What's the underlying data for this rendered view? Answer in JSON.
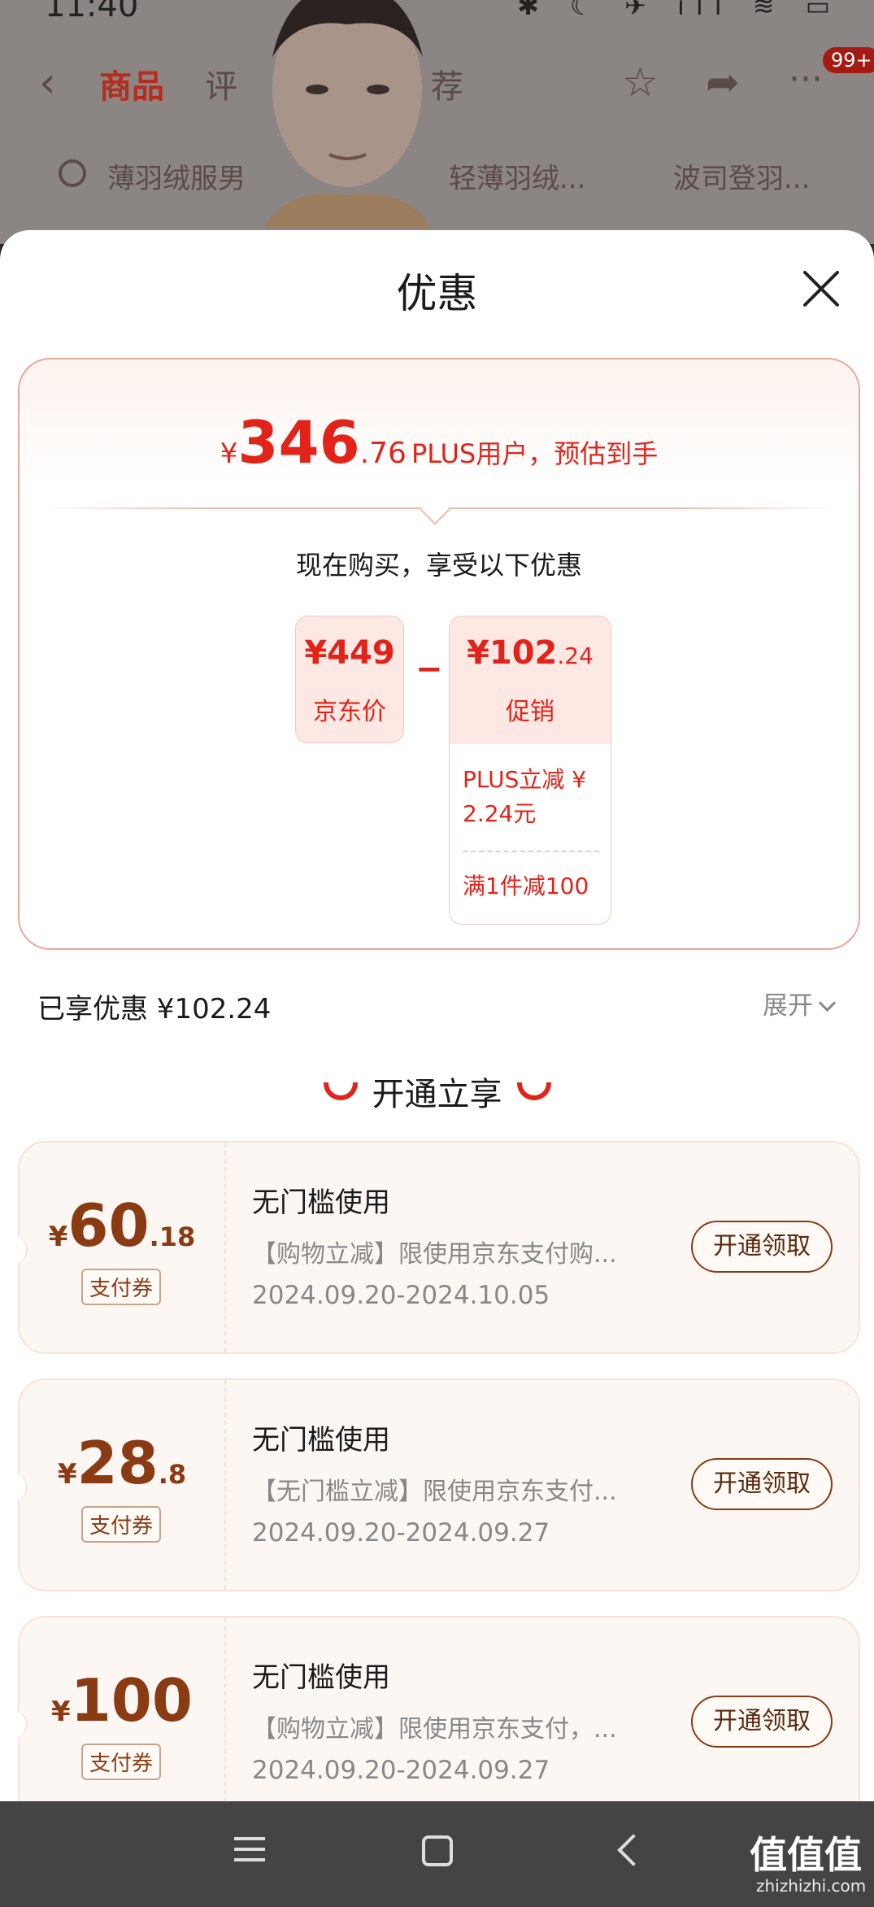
{
  "status": {
    "time": "11:40",
    "icons": "✱ ☾ ✈ ıll ≋ ▭"
  },
  "bg_nav": {
    "tabs": [
      "商品",
      "评",
      "",
      "荐"
    ],
    "badge": "99+",
    "chips": [
      "薄羽绒服男",
      "轻薄羽绒...",
      "波司登羽..."
    ]
  },
  "sheet": {
    "title": "优惠"
  },
  "estimate": {
    "currency": "¥",
    "integer": "346",
    "decimal": ".76",
    "label": "PLUS用户，预估到手"
  },
  "buy_now_text": "现在购买，享受以下优惠",
  "jd_price": {
    "amount": "¥449",
    "label": "京东价"
  },
  "minus": "−",
  "promotion": {
    "amount_int": "¥102",
    "amount_dec": ".24",
    "label": "促销",
    "items": [
      "PLUS立减 ¥ 2.24元",
      "满1件减100"
    ]
  },
  "enjoyed": "已享优惠 ¥102.24",
  "expand": "展开",
  "section_title": "开通立享",
  "coupons": [
    {
      "currency": "¥",
      "integer": "60",
      "decimal": ".18",
      "tag": "支付券",
      "title": "无门槛使用",
      "desc": "【购物立减】限使用京东支付购...",
      "date": "2024.09.20-2024.10.05",
      "button": "开通领取"
    },
    {
      "currency": "¥",
      "integer": "28",
      "decimal": ".8",
      "tag": "支付券",
      "title": "无门槛使用",
      "desc": "【无门槛立减】限使用京东支付...",
      "date": "2024.09.20-2024.09.27",
      "button": "开通领取"
    },
    {
      "currency": "¥",
      "integer": "100",
      "decimal": "",
      "tag": "支付券",
      "title": "无门槛使用",
      "desc": "【购物立减】限使用京东支付，...",
      "date": "2024.09.20-2024.09.27",
      "button": "开通领取"
    }
  ],
  "watermark": {
    "main": "值值值",
    "sub": "zhizhizhi.com"
  },
  "colors": {
    "accent": "#e2231a",
    "coupon_brown": "#8a3b14"
  }
}
